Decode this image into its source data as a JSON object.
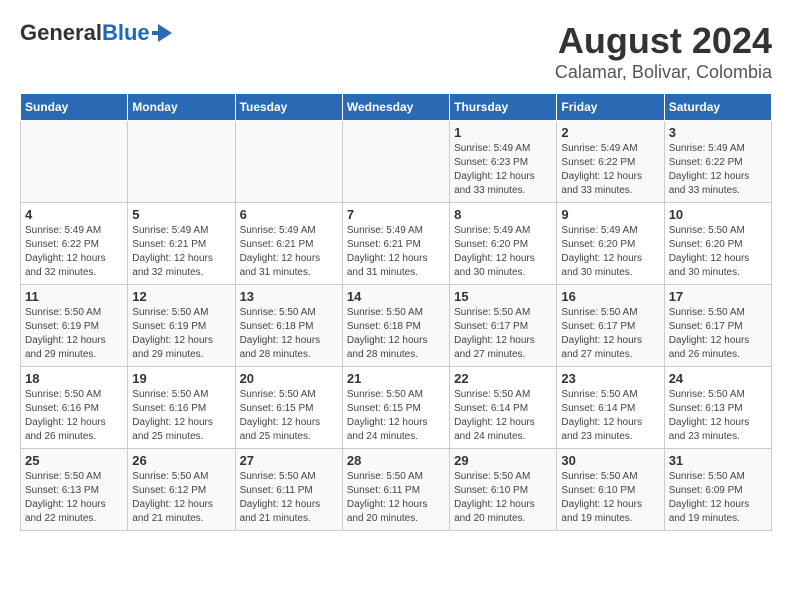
{
  "header": {
    "logo_line1": "General",
    "logo_line2": "Blue",
    "title": "August 2024",
    "subtitle": "Calamar, Bolivar, Colombia"
  },
  "columns": [
    "Sunday",
    "Monday",
    "Tuesday",
    "Wednesday",
    "Thursday",
    "Friday",
    "Saturday"
  ],
  "weeks": [
    [
      {
        "day": "",
        "info": ""
      },
      {
        "day": "",
        "info": ""
      },
      {
        "day": "",
        "info": ""
      },
      {
        "day": "",
        "info": ""
      },
      {
        "day": "1",
        "info": "Sunrise: 5:49 AM\nSunset: 6:23 PM\nDaylight: 12 hours\nand 33 minutes."
      },
      {
        "day": "2",
        "info": "Sunrise: 5:49 AM\nSunset: 6:22 PM\nDaylight: 12 hours\nand 33 minutes."
      },
      {
        "day": "3",
        "info": "Sunrise: 5:49 AM\nSunset: 6:22 PM\nDaylight: 12 hours\nand 33 minutes."
      }
    ],
    [
      {
        "day": "4",
        "info": "Sunrise: 5:49 AM\nSunset: 6:22 PM\nDaylight: 12 hours\nand 32 minutes."
      },
      {
        "day": "5",
        "info": "Sunrise: 5:49 AM\nSunset: 6:21 PM\nDaylight: 12 hours\nand 32 minutes."
      },
      {
        "day": "6",
        "info": "Sunrise: 5:49 AM\nSunset: 6:21 PM\nDaylight: 12 hours\nand 31 minutes."
      },
      {
        "day": "7",
        "info": "Sunrise: 5:49 AM\nSunset: 6:21 PM\nDaylight: 12 hours\nand 31 minutes."
      },
      {
        "day": "8",
        "info": "Sunrise: 5:49 AM\nSunset: 6:20 PM\nDaylight: 12 hours\nand 30 minutes."
      },
      {
        "day": "9",
        "info": "Sunrise: 5:49 AM\nSunset: 6:20 PM\nDaylight: 12 hours\nand 30 minutes."
      },
      {
        "day": "10",
        "info": "Sunrise: 5:50 AM\nSunset: 6:20 PM\nDaylight: 12 hours\nand 30 minutes."
      }
    ],
    [
      {
        "day": "11",
        "info": "Sunrise: 5:50 AM\nSunset: 6:19 PM\nDaylight: 12 hours\nand 29 minutes."
      },
      {
        "day": "12",
        "info": "Sunrise: 5:50 AM\nSunset: 6:19 PM\nDaylight: 12 hours\nand 29 minutes."
      },
      {
        "day": "13",
        "info": "Sunrise: 5:50 AM\nSunset: 6:18 PM\nDaylight: 12 hours\nand 28 minutes."
      },
      {
        "day": "14",
        "info": "Sunrise: 5:50 AM\nSunset: 6:18 PM\nDaylight: 12 hours\nand 28 minutes."
      },
      {
        "day": "15",
        "info": "Sunrise: 5:50 AM\nSunset: 6:17 PM\nDaylight: 12 hours\nand 27 minutes."
      },
      {
        "day": "16",
        "info": "Sunrise: 5:50 AM\nSunset: 6:17 PM\nDaylight: 12 hours\nand 27 minutes."
      },
      {
        "day": "17",
        "info": "Sunrise: 5:50 AM\nSunset: 6:17 PM\nDaylight: 12 hours\nand 26 minutes."
      }
    ],
    [
      {
        "day": "18",
        "info": "Sunrise: 5:50 AM\nSunset: 6:16 PM\nDaylight: 12 hours\nand 26 minutes."
      },
      {
        "day": "19",
        "info": "Sunrise: 5:50 AM\nSunset: 6:16 PM\nDaylight: 12 hours\nand 25 minutes."
      },
      {
        "day": "20",
        "info": "Sunrise: 5:50 AM\nSunset: 6:15 PM\nDaylight: 12 hours\nand 25 minutes."
      },
      {
        "day": "21",
        "info": "Sunrise: 5:50 AM\nSunset: 6:15 PM\nDaylight: 12 hours\nand 24 minutes."
      },
      {
        "day": "22",
        "info": "Sunrise: 5:50 AM\nSunset: 6:14 PM\nDaylight: 12 hours\nand 24 minutes."
      },
      {
        "day": "23",
        "info": "Sunrise: 5:50 AM\nSunset: 6:14 PM\nDaylight: 12 hours\nand 23 minutes."
      },
      {
        "day": "24",
        "info": "Sunrise: 5:50 AM\nSunset: 6:13 PM\nDaylight: 12 hours\nand 23 minutes."
      }
    ],
    [
      {
        "day": "25",
        "info": "Sunrise: 5:50 AM\nSunset: 6:13 PM\nDaylight: 12 hours\nand 22 minutes."
      },
      {
        "day": "26",
        "info": "Sunrise: 5:50 AM\nSunset: 6:12 PM\nDaylight: 12 hours\nand 21 minutes."
      },
      {
        "day": "27",
        "info": "Sunrise: 5:50 AM\nSunset: 6:11 PM\nDaylight: 12 hours\nand 21 minutes."
      },
      {
        "day": "28",
        "info": "Sunrise: 5:50 AM\nSunset: 6:11 PM\nDaylight: 12 hours\nand 20 minutes."
      },
      {
        "day": "29",
        "info": "Sunrise: 5:50 AM\nSunset: 6:10 PM\nDaylight: 12 hours\nand 20 minutes."
      },
      {
        "day": "30",
        "info": "Sunrise: 5:50 AM\nSunset: 6:10 PM\nDaylight: 12 hours\nand 19 minutes."
      },
      {
        "day": "31",
        "info": "Sunrise: 5:50 AM\nSunset: 6:09 PM\nDaylight: 12 hours\nand 19 minutes."
      }
    ]
  ]
}
